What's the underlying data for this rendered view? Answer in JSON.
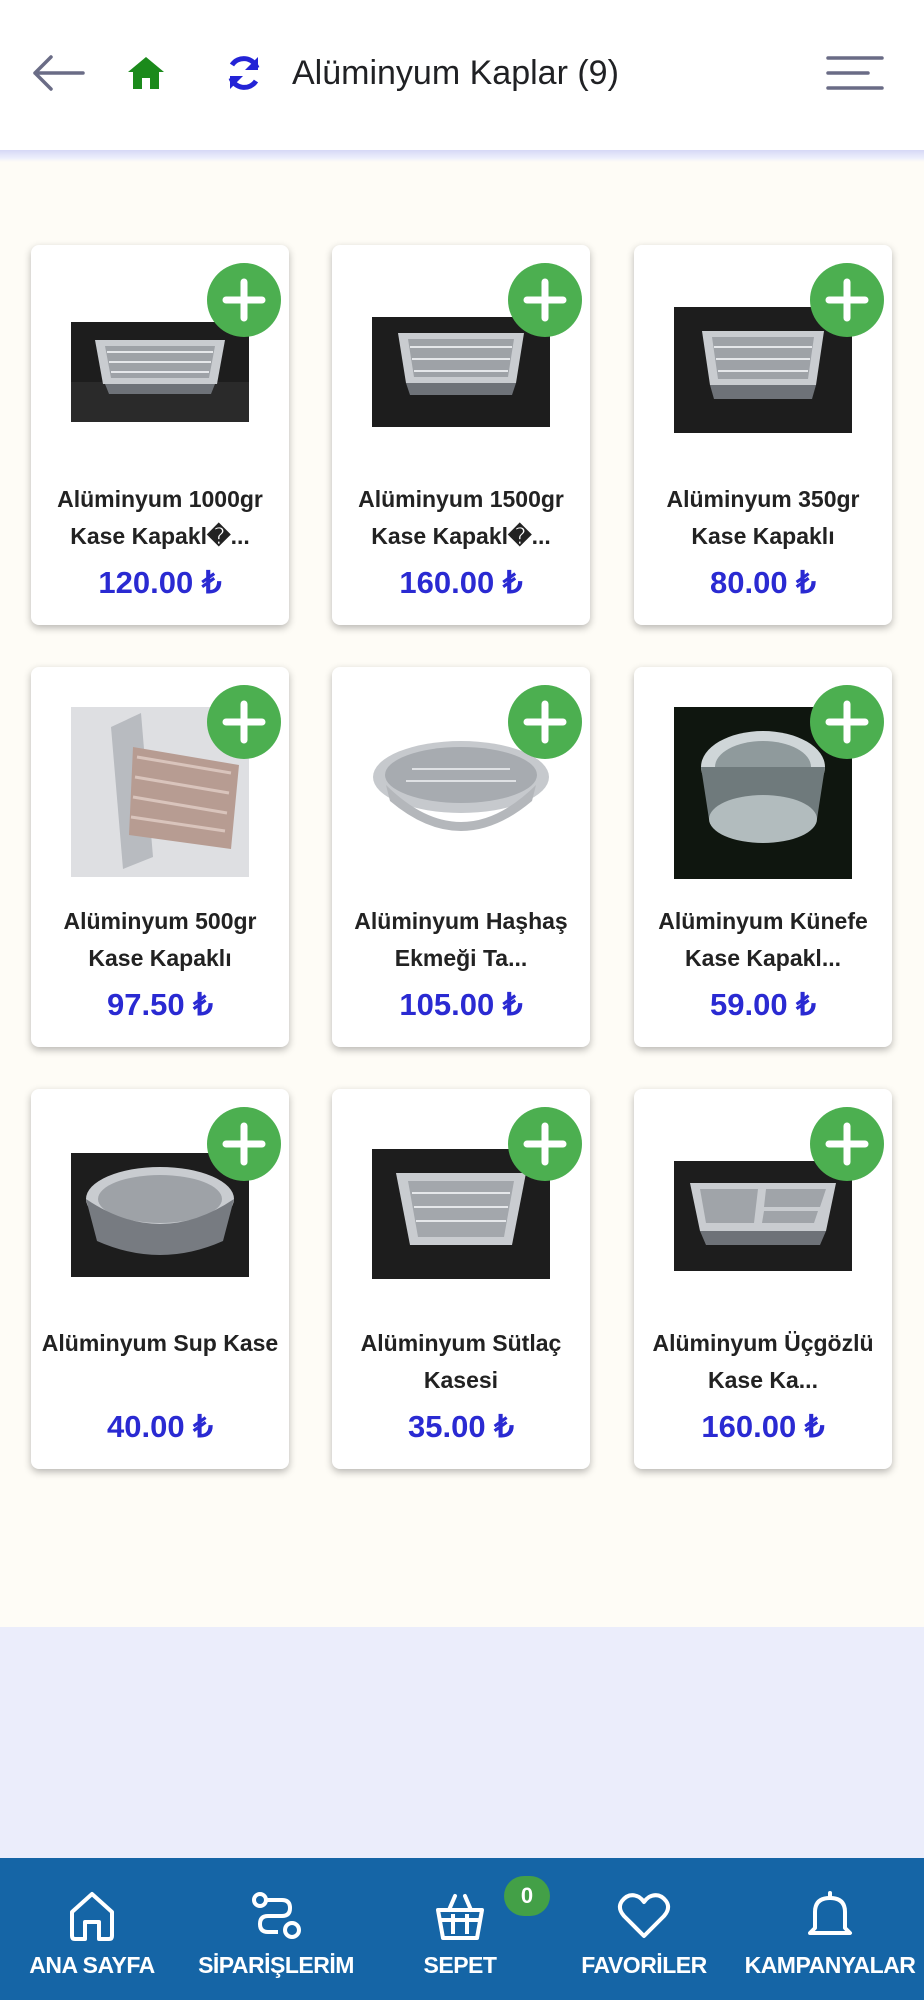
{
  "header": {
    "title": "Alüminyum Kaplar (9)",
    "icons": [
      "back-arrow-icon",
      "home-icon",
      "refresh-icon",
      "menu-icon"
    ]
  },
  "colors": {
    "accent_green": "#4caf50",
    "price_blue": "#2a2ad2",
    "nav_blue": "#1565a6",
    "home_green": "#1b8a1b",
    "refresh_blue": "#2323d6"
  },
  "products": [
    {
      "name": "Alüminyum 1000gr Kase Kapakl�...",
      "price": "120.00 ₺"
    },
    {
      "name": "Alüminyum 1500gr Kase Kapakl�...",
      "price": "160.00 ₺"
    },
    {
      "name": "Alüminyum 350gr Kase Kapaklı",
      "price": "80.00 ₺"
    },
    {
      "name": "Alüminyum 500gr Kase Kapaklı",
      "price": "97.50 ₺"
    },
    {
      "name": "Alüminyum Haşhaş Ekmeği Ta...",
      "price": "105.00 ₺"
    },
    {
      "name": "Alüminyum Künefe Kase Kapakl...",
      "price": "59.00 ₺"
    },
    {
      "name": "Alüminyum Sup Kase",
      "price": "40.00 ₺"
    },
    {
      "name": "Alüminyum Sütlaç Kasesi",
      "price": "35.00 ₺"
    },
    {
      "name": "Alüminyum Üçgözlü Kase Ka...",
      "price": "160.00 ₺"
    }
  ],
  "bottom_nav": {
    "items": [
      {
        "label": "ANA SAYFA",
        "icon": "home-outline-icon"
      },
      {
        "label": "SİPARİŞLERİM",
        "icon": "route-icon"
      },
      {
        "label": "SEPET",
        "icon": "basket-icon"
      },
      {
        "label": "FAVORİLER",
        "icon": "heart-icon"
      },
      {
        "label": "KAMPANYALAR",
        "icon": "bell-icon"
      }
    ],
    "cart_count": "0"
  }
}
